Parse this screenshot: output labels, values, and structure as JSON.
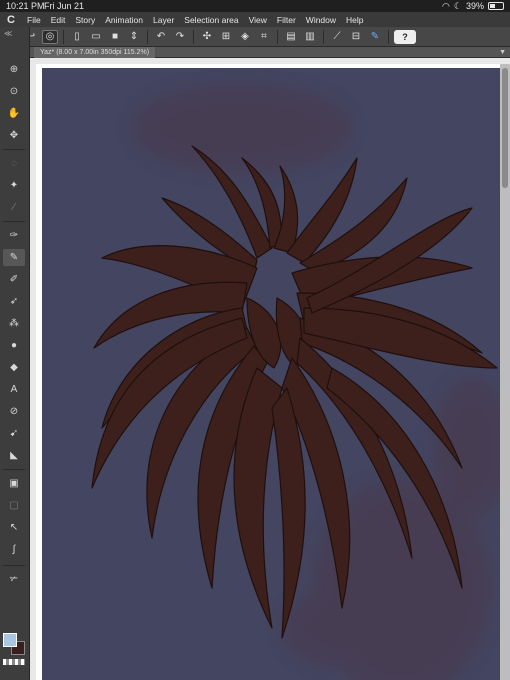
{
  "status": {
    "time": "10:21 PM",
    "date": "Fri Jun 21",
    "battery": "39%",
    "battery_level": 0.39
  },
  "app": {
    "logo": "C"
  },
  "menu": [
    "File",
    "Edit",
    "Story",
    "Animation",
    "Layer",
    "Selection area",
    "View",
    "Filter",
    "Window",
    "Help"
  ],
  "command_icons": [
    "grid-icon",
    "back-icon",
    "spiral-icon",
    "new-icon",
    "open-icon",
    "save-icon",
    "stepper-icon",
    "undo-icon",
    "redo-icon",
    "brush-settings-icon",
    "transform-icon",
    "clear-icon",
    "fit-icon",
    "layer-icon",
    "snap-icon",
    "ruler-icon",
    "pen-icon",
    "help-icon"
  ],
  "document_tab": {
    "label": "Yaz* (8.00 x 7.00in 350dpi 115.2%)"
  },
  "tools": [
    "zoom",
    "zoom-alt",
    "hand",
    "move",
    "lasso",
    "wand",
    "eyedropper",
    "pen",
    "pencil",
    "brush",
    "airbrush",
    "eraser",
    "decoration",
    "blend",
    "fill",
    "text",
    "bandage",
    "operation",
    "line",
    "gradient",
    "frame",
    "ruler",
    "bezier",
    "correct-line"
  ],
  "colors": {
    "main": "#a9c6e0",
    "sub": "#3a1f1f",
    "background": "#434561",
    "hair": "#3d201c",
    "hair_dark": "#1f0f0d",
    "blotch": "#4a3848"
  }
}
